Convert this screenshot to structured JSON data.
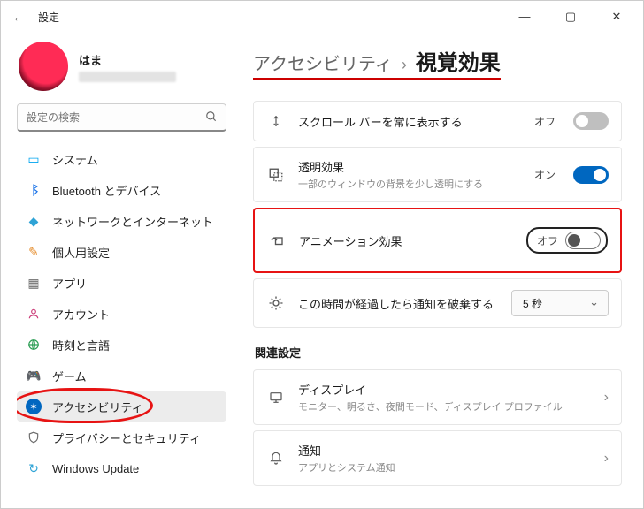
{
  "titlebar": {
    "title": "設定"
  },
  "profile": {
    "name": "はま"
  },
  "search": {
    "placeholder": "設定の検索"
  },
  "sidebar": {
    "items": [
      {
        "label": "システム"
      },
      {
        "label": "Bluetooth とデバイス"
      },
      {
        "label": "ネットワークとインターネット"
      },
      {
        "label": "個人用設定"
      },
      {
        "label": "アプリ"
      },
      {
        "label": "アカウント"
      },
      {
        "label": "時刻と言語"
      },
      {
        "label": "ゲーム"
      },
      {
        "label": "アクセシビリティ"
      },
      {
        "label": "プライバシーとセキュリティ"
      },
      {
        "label": "Windows Update"
      }
    ]
  },
  "breadcrumb": {
    "parent": "アクセシビリティ",
    "sep": "›",
    "current": "視覚効果"
  },
  "rows": {
    "scrollbar": {
      "title": "スクロール バーを常に表示する",
      "state": "オフ"
    },
    "transparency": {
      "title": "透明効果",
      "sub": "一部のウィンドウの背景を少し透明にする",
      "state": "オン"
    },
    "animation": {
      "title": "アニメーション効果",
      "state": "オフ"
    },
    "dismiss": {
      "title": "この時間が経過したら通知を破棄する",
      "value": "5 秒"
    }
  },
  "related": {
    "heading": "関連設定",
    "display": {
      "title": "ディスプレイ",
      "sub": "モニター、明るさ、夜間モード、ディスプレイ プロファイル"
    },
    "notifications": {
      "title": "通知",
      "sub": "アプリとシステム通知"
    }
  }
}
